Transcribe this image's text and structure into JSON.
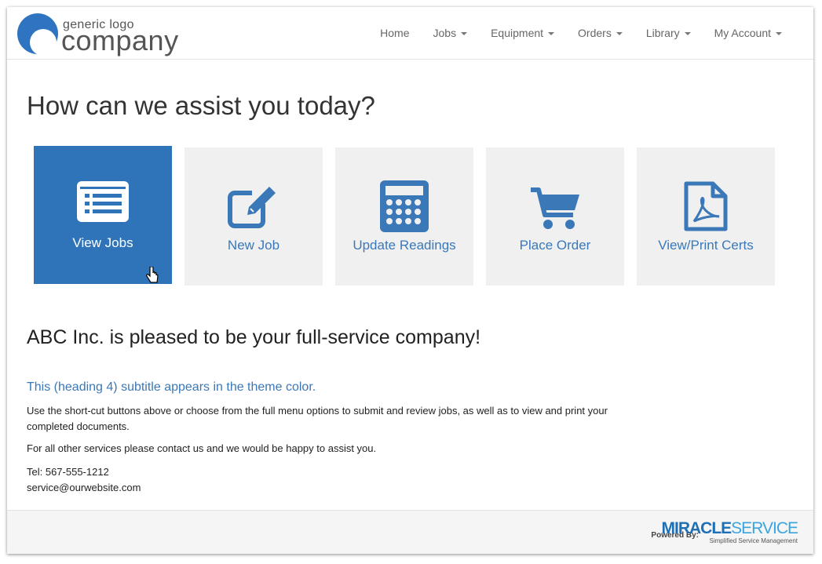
{
  "logo": {
    "small": "generic logo",
    "big": "company"
  },
  "nav": [
    {
      "label": "Home",
      "dropdown": false
    },
    {
      "label": "Jobs",
      "dropdown": true
    },
    {
      "label": "Equipment",
      "dropdown": true
    },
    {
      "label": "Orders",
      "dropdown": true
    },
    {
      "label": "Library",
      "dropdown": true
    },
    {
      "label": "My Account",
      "dropdown": true
    }
  ],
  "hero_title": "How can we assist you today?",
  "tiles": [
    {
      "label": "View Jobs",
      "icon": "list-icon",
      "active": true
    },
    {
      "label": "New Job",
      "icon": "edit-icon",
      "active": false
    },
    {
      "label": "Update Readings",
      "icon": "calculator-icon",
      "active": false
    },
    {
      "label": "Place Order",
      "icon": "cart-icon",
      "active": false
    },
    {
      "label": "View/Print Certs",
      "icon": "pdf-file-icon",
      "active": false
    }
  ],
  "content": {
    "heading": "ABC Inc. is pleased to be your full-service company!",
    "subtitle": "This (heading 4) subtitle appears in the theme color.",
    "paragraph1": "Use the short-cut buttons above or choose from the full menu options to submit and review jobs, as well as to view and print your completed documents.",
    "paragraph2": "For all other services please contact us and we would be happy to assist you.",
    "tel": "Tel: 567-555-1212",
    "email": "service@ourwebsite.com"
  },
  "footer": {
    "powered_by": "Powered By:",
    "brand_bold": "MIRACLE",
    "brand_light": "SERVICE",
    "brand_tagline": "Simplified Service Management"
  },
  "colors": {
    "theme": "#2f74b8",
    "tile_bg": "#f0f0f0",
    "link": "#3a78b8"
  }
}
